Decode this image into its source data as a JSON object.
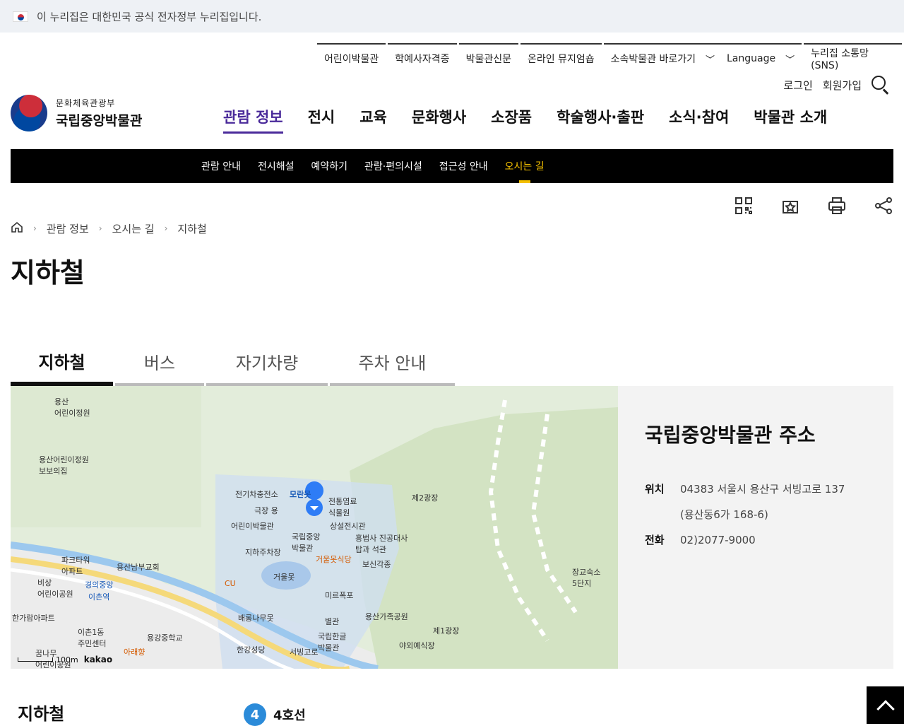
{
  "gov_banner": {
    "text": "이 누리집은 대한민국 공식 전자정부 누리집입니다."
  },
  "util_links": [
    {
      "label": "어린이박물관"
    },
    {
      "label": "학예사자격증"
    },
    {
      "label": "박물관신문"
    },
    {
      "label": "온라인 뮤지엄숍"
    },
    {
      "label": "소속박물관 바로가기"
    }
  ],
  "util_links2": [
    {
      "label": "Language"
    },
    {
      "label": "누리집 소통망(SNS)"
    }
  ],
  "account": {
    "login": "로그인",
    "signup": "회원가입"
  },
  "logo": {
    "ministry": "문화체육관광부",
    "museum": "국립중앙박물관"
  },
  "gnb": [
    {
      "label": "관람 정보"
    },
    {
      "label": "전시"
    },
    {
      "label": "교육"
    },
    {
      "label": "문화행사"
    },
    {
      "label": "소장품"
    },
    {
      "label": "학술행사·출판"
    },
    {
      "label": "소식·참여"
    },
    {
      "label": "박물관 소개"
    }
  ],
  "sub_nav": [
    {
      "label": "관람 안내"
    },
    {
      "label": "전시해설"
    },
    {
      "label": "예약하기"
    },
    {
      "label": "관람·편의시설"
    },
    {
      "label": "접근성 안내"
    },
    {
      "label": "오시는 길"
    }
  ],
  "breadcrumb": [
    "관람 정보",
    "오시는 길",
    "지하철"
  ],
  "page_title": "지하철",
  "tabs": [
    {
      "label": "지하철"
    },
    {
      "label": "버스"
    },
    {
      "label": "자기차량"
    },
    {
      "label": "주차 안내"
    }
  ],
  "map": {
    "labels": [
      "용산\n어린이정원",
      "용산어린이정원\n보보의집",
      "전기차충전소",
      "모란못",
      "전통염료\n식물원",
      "극장 용",
      "어린이박물관",
      "국립중앙\n박물관",
      "상설전시관",
      "흥법사 진공대사\n탑과 석관",
      "지하주차장",
      "거울못식당",
      "보신각종",
      "거울못",
      "미르폭포",
      "용산가족공원",
      "배롱나무못",
      "별관",
      "국립한글\n박물관",
      "제1광장",
      "야외예식장",
      "제2광장",
      "장교숙소\n5단지",
      "파크타워\n아파트",
      "용산남부교회",
      "비상\n어린이공원",
      "경의중앙",
      "이촌역",
      "CU",
      "한가람아파트",
      "이촌1동\n주민센터",
      "용강중학교",
      "아래향",
      "한강성당",
      "서빙고로",
      "꿈나무\n어린이공원"
    ],
    "scale": "100m",
    "brand": "kakao"
  },
  "address_panel": {
    "title": "국립중앙박물관 주소",
    "location_label": "위치",
    "location_line1": "04383 서울시 용산구 서빙고로 137",
    "location_line2": "(용산동6가 168-6)",
    "phone_label": "전화",
    "phone": "02)2077-9000"
  },
  "section": {
    "title": "지하철",
    "line_no": "4",
    "line_name": "4호선"
  }
}
